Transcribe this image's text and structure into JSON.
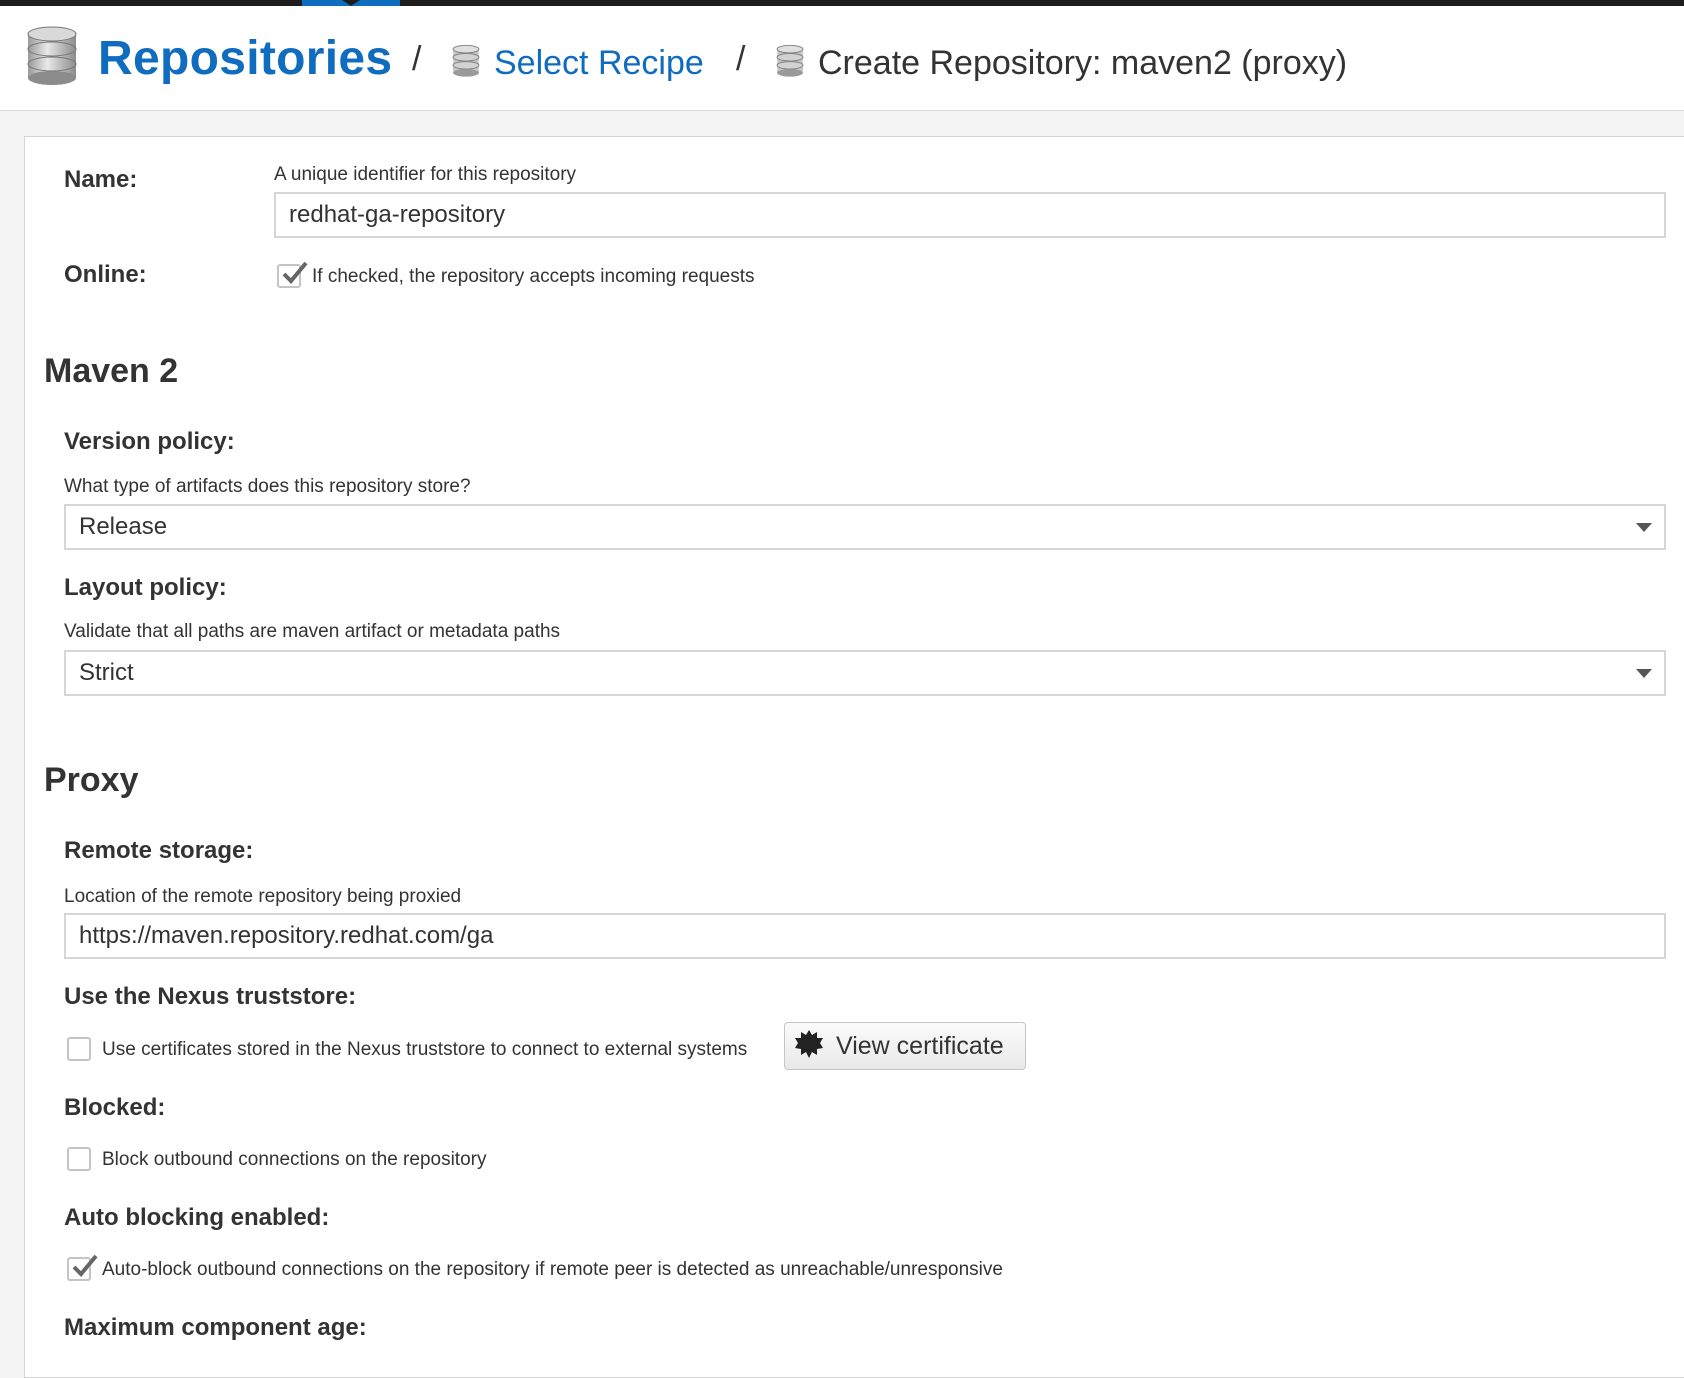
{
  "breadcrumb": {
    "root": "Repositories",
    "separator": "/",
    "recipe": "Select Recipe",
    "current": "Create Repository: maven2 (proxy)"
  },
  "form": {
    "name": {
      "label": "Name:",
      "help": "A unique identifier for this repository",
      "value": "redhat-ga-repository"
    },
    "online": {
      "label": "Online:",
      "checked": true,
      "text": "If checked, the repository accepts incoming requests"
    },
    "maven": {
      "heading": "Maven 2",
      "version_policy": {
        "label": "Version policy:",
        "help": "What type of artifacts does this repository store?",
        "value": "Release"
      },
      "layout_policy": {
        "label": "Layout policy:",
        "help": "Validate that all paths are maven artifact or metadata paths",
        "value": "Strict"
      }
    },
    "proxy": {
      "heading": "Proxy",
      "remote_storage": {
        "label": "Remote storage:",
        "help": "Location of the remote repository being proxied",
        "value": "https://maven.repository.redhat.com/ga"
      },
      "truststore": {
        "label": "Use the Nexus truststore:",
        "checked": false,
        "text": "Use certificates stored in the Nexus truststore to connect to external systems",
        "button": "View certificate"
      },
      "blocked": {
        "label": "Blocked:",
        "checked": false,
        "text": "Block outbound connections on the repository"
      },
      "auto_blocking": {
        "label": "Auto blocking enabled:",
        "checked": true,
        "text": "Auto-block outbound connections on the repository if remote peer is detected as unreachable/unresponsive"
      },
      "max_component_age": {
        "label": "Maximum component age:"
      }
    }
  },
  "colors": {
    "link": "#0f6cbf",
    "topbar": "#1e1e1e"
  },
  "icons": {
    "breadcrumb": "database-icon",
    "certificate": "certificate-icon",
    "dropdown": "caret-down-icon"
  }
}
